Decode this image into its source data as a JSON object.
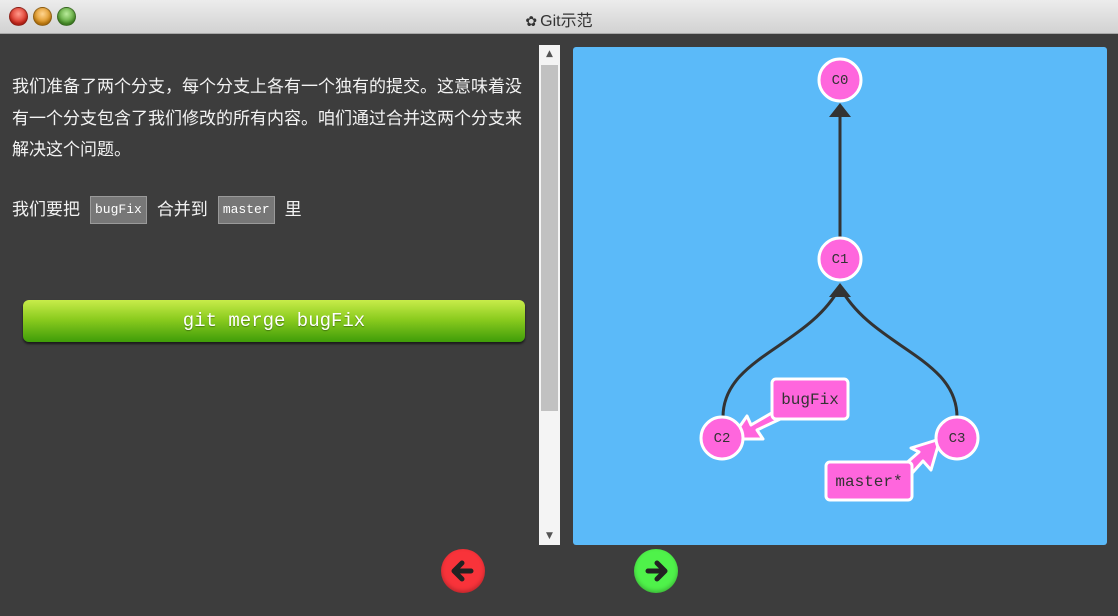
{
  "window": {
    "title": "Git示范"
  },
  "instructions": {
    "paragraph1": "我们准备了两个分支，每个分支上各有一个独有的提交。这意味着没有一个分支包含了我们修改的所有内容。咱们通过合并这两个分支来解决这个问题。",
    "line2_prefix": "我们要把",
    "branch_a": "bugFix",
    "line2_mid": "合并到",
    "branch_b": "master",
    "line2_suffix": "里"
  },
  "command_button": {
    "label": "git merge bugFix"
  },
  "graph": {
    "commits": [
      {
        "id": "C0"
      },
      {
        "id": "C1"
      },
      {
        "id": "C2"
      },
      {
        "id": "C3"
      }
    ],
    "branches": [
      {
        "name": "bugFix",
        "target": "C2"
      },
      {
        "name": "master*",
        "target": "C3"
      }
    ],
    "colors": {
      "background": "#5bbaf9",
      "commit_fill": "#ff66dd",
      "commit_stroke": "#ffffff",
      "branch_label_fill": "#ff66dd",
      "edge": "#333333"
    }
  },
  "navigation": {
    "back_icon": "arrow-left-icon",
    "forward_icon": "arrow-right-icon"
  },
  "icons": {
    "title_icon": "gear-icon"
  }
}
